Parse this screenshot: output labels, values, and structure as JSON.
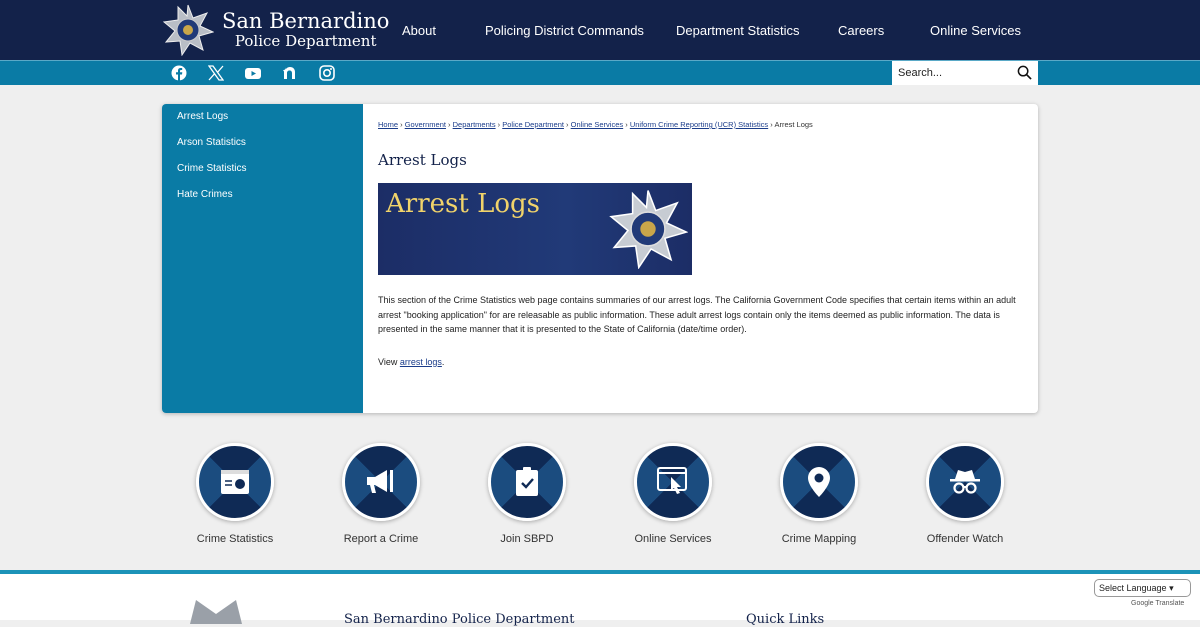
{
  "header": {
    "brand_line1": "San Bernardino",
    "brand_line2": "Police Department",
    "nav": [
      "About",
      "Policing District Commands",
      "Department Statistics",
      "Careers",
      "Online Services"
    ]
  },
  "social": [
    "facebook-icon",
    "x-icon",
    "youtube-icon",
    "nextdoor-icon",
    "instagram-icon"
  ],
  "search": {
    "placeholder": "Search..."
  },
  "sidebar": [
    "Arrest Logs",
    "Arson Statistics",
    "Crime Statistics",
    "Hate Crimes"
  ],
  "breadcrumb": {
    "links": [
      "Home",
      "Government",
      "Departments",
      "Police Department",
      "Online Services",
      "Uniform Crime Reporting (UCR) Statistics"
    ],
    "current": "Arrest Logs"
  },
  "page": {
    "title": "Arrest Logs",
    "banner_text": "Arrest Logs",
    "body": "This section of the Crime Statistics web page contains summaries of our arrest logs. The California Government Code specifies that certain items within an adult arrest \"booking application\" for are releasable as public information. These adult arrest logs contain only the items deemed as public information. The data is presented in the same manner that it is presented to the State of California (date/time order).",
    "view_prefix": "View ",
    "view_link": "arrest logs",
    "view_suffix": "."
  },
  "tiles": [
    "Crime Statistics",
    "Report a Crime",
    "Join SBPD",
    "Online Services",
    "Crime Mapping",
    "Offender Watch"
  ],
  "footer": {
    "name": "San Bernardino Police Department",
    "quick_links": "Quick Links"
  },
  "translate": {
    "select": "Select Language",
    "powered": "Google Translate"
  }
}
